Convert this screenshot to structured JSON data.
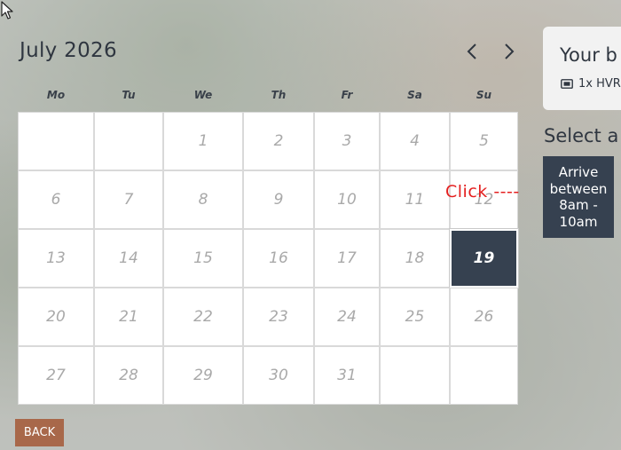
{
  "calendar": {
    "month_label": "July 2026",
    "prev_icon": "‹",
    "next_icon": "›",
    "weekdays": [
      "Mo",
      "Tu",
      "We",
      "Th",
      "Fr",
      "Sa",
      "Su"
    ],
    "weeks": [
      [
        "",
        "",
        "1",
        "2",
        "3",
        "4",
        "5"
      ],
      [
        "6",
        "7",
        "8",
        "9",
        "10",
        "11",
        "12"
      ],
      [
        "13",
        "14",
        "15",
        "16",
        "17",
        "18",
        "19"
      ],
      [
        "20",
        "21",
        "22",
        "23",
        "24",
        "25",
        "26"
      ],
      [
        "27",
        "28",
        "29",
        "30",
        "31",
        "",
        ""
      ]
    ],
    "selected_day": "19"
  },
  "back_button": {
    "label": "BACK"
  },
  "booking_panel": {
    "title": "Your b",
    "ticket_text": "1x HVR",
    "ticket_icon": "ticket-icon"
  },
  "slots": {
    "heading": "Select a",
    "items": [
      {
        "label": "Arrive\nbetween\n8am -\n10am"
      }
    ]
  },
  "annotation": {
    "text": "Click ----"
  },
  "colors": {
    "selected_bg": "#364150",
    "back_bg": "#a8684a",
    "annotation": "#e41f1f",
    "text_dark": "#2f3640",
    "day_muted": "#a9a9a9"
  }
}
